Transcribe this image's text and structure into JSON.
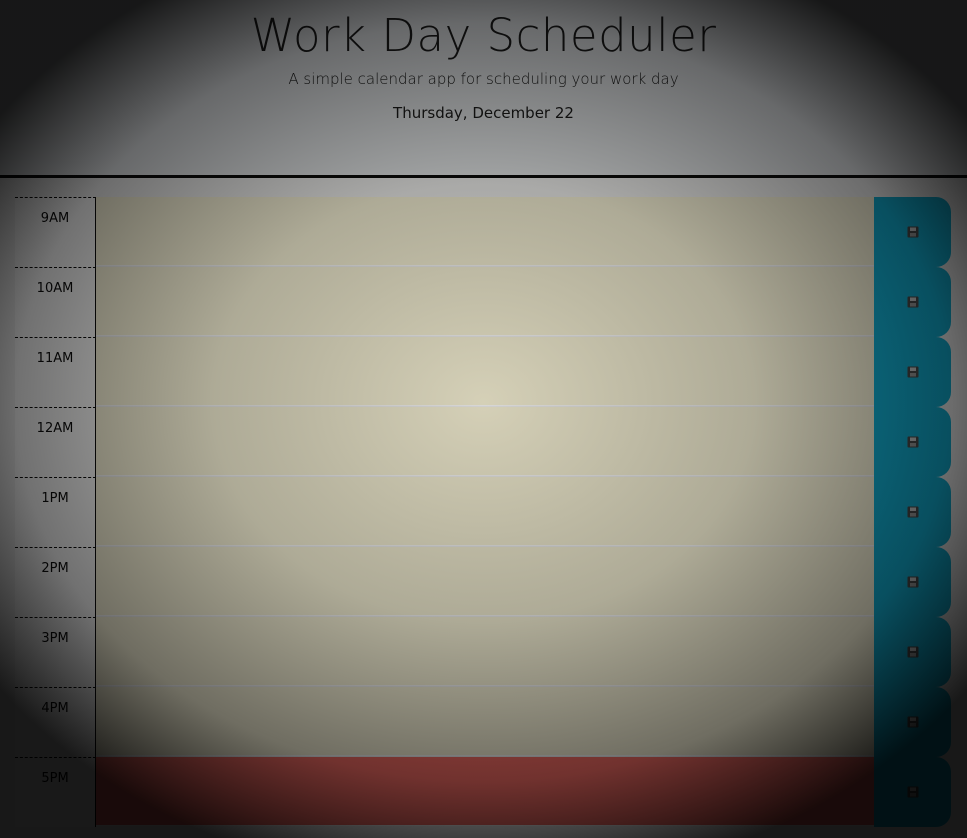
{
  "header": {
    "title": "Work Day Scheduler",
    "lead": "A simple calendar app for scheduling your work day",
    "current_day": "Thursday, December 22"
  },
  "time_blocks": [
    {
      "hour": "9AM",
      "status": "past",
      "text": ""
    },
    {
      "hour": "10AM",
      "status": "past",
      "text": ""
    },
    {
      "hour": "11AM",
      "status": "past",
      "text": ""
    },
    {
      "hour": "12AM",
      "status": "past",
      "text": ""
    },
    {
      "hour": "1PM",
      "status": "past",
      "text": ""
    },
    {
      "hour": "2PM",
      "status": "past",
      "text": ""
    },
    {
      "hour": "3PM",
      "status": "past",
      "text": ""
    },
    {
      "hour": "4PM",
      "status": "past",
      "text": ""
    },
    {
      "hour": "5PM",
      "status": "present",
      "text": ""
    }
  ],
  "save_icon": "floppy-disk-icon",
  "colors": {
    "past": "#d3d3d3",
    "present": "#ff6961",
    "future": "#77dd77",
    "save_button": "#06aed5",
    "header_bg": "#e9ecef"
  }
}
